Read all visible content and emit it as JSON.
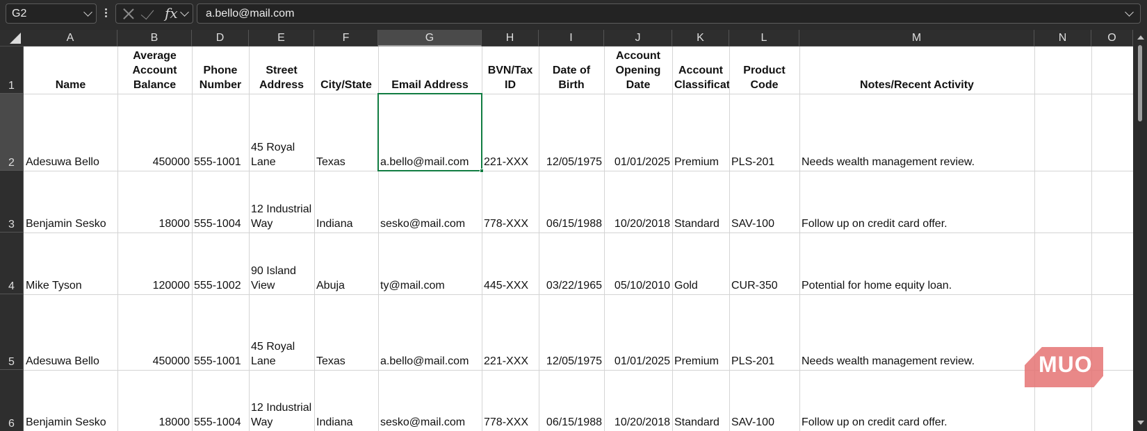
{
  "formula_bar": {
    "name_box": "G2",
    "fx_label": "fx",
    "formula_value": "a.bello@mail.com"
  },
  "columns": [
    "A",
    "B",
    "D",
    "E",
    "F",
    "G",
    "H",
    "I",
    "J",
    "K",
    "L",
    "M",
    "N",
    "O"
  ],
  "rows": [
    "1",
    "2",
    "3",
    "4",
    "5",
    "6"
  ],
  "headers": {
    "A": "Name",
    "B": "Average Account Balance",
    "D": "Phone Number",
    "E": "Street Address",
    "F": "City/State",
    "G": "Email Address",
    "H": "BVN/Tax ID",
    "I": "Date of Birth",
    "J": "Account Opening Date",
    "K": "Account Classification",
    "L": "Product Code",
    "M": "Notes/Recent Activity"
  },
  "records": [
    {
      "name": "Adesuwa Bello",
      "balance": "450000",
      "phone": "555-1001",
      "street": "45 Royal Lane",
      "city": "Texas",
      "email": "a.bello@mail.com",
      "tax_id": "221-XXX",
      "dob": "12/05/1975",
      "open_date": "01/01/2025",
      "class": "Premium",
      "code": "PLS-201",
      "notes": "Needs wealth management review."
    },
    {
      "name": "Benjamin Sesko",
      "balance": "18000",
      "phone": "555-1004",
      "street": "12 Industrial Way",
      "city": "Indiana",
      "email": "sesko@mail.com",
      "tax_id": "778-XXX",
      "dob": "06/15/1988",
      "open_date": "10/20/2018",
      "class": "Standard",
      "code": "SAV-100",
      "notes": "Follow up on credit card offer."
    },
    {
      "name": "Mike Tyson",
      "balance": "120000",
      "phone": "555-1002",
      "street": "90 Island View",
      "city": "Abuja",
      "email": "ty@mail.com",
      "tax_id": "445-XXX",
      "dob": "03/22/1965",
      "open_date": "05/10/2010",
      "class": "Gold",
      "code": "CUR-350",
      "notes": "Potential for home equity loan."
    },
    {
      "name": "Adesuwa Bello",
      "balance": "450000",
      "phone": "555-1001",
      "street": "45 Royal Lane",
      "city": "Texas",
      "email": "a.bello@mail.com",
      "tax_id": "221-XXX",
      "dob": "12/05/1975",
      "open_date": "01/01/2025",
      "class": "Premium",
      "code": "PLS-201",
      "notes": "Needs wealth management review."
    },
    {
      "name": "Benjamin Sesko",
      "balance": "18000",
      "phone": "555-1004",
      "street": "12 Industrial Way",
      "city": "Indiana",
      "email": "sesko@mail.com",
      "tax_id": "778-XXX",
      "dob": "06/15/1988",
      "open_date": "10/20/2018",
      "class": "Standard",
      "code": "SAV-100",
      "notes": "Follow up on credit card offer."
    }
  ],
  "selected_cell": "G2",
  "watermark": "MUO"
}
